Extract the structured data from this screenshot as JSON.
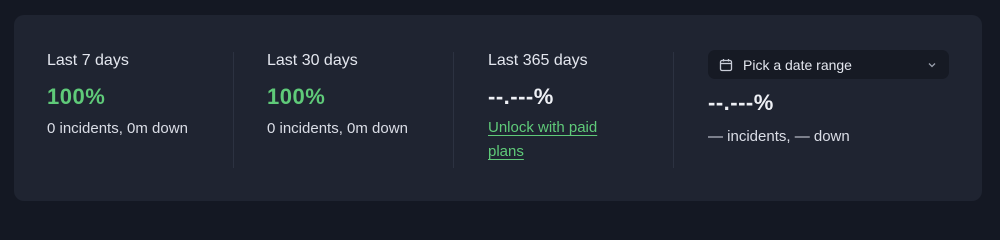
{
  "stats": [
    {
      "period": "Last 7 days",
      "value": "100%",
      "summary": "0 incidents, 0m down"
    },
    {
      "period": "Last 30 days",
      "value": "100%",
      "summary": "0 incidents, 0m down"
    },
    {
      "period": "Last 365 days",
      "value": "--.---%",
      "unlock_link": "Unlock with paid plans"
    }
  ],
  "custom_range": {
    "picker_label": "Pick a date range",
    "value": "--.---%",
    "summary": "— incidents, — down"
  },
  "colors": {
    "background": "#141823",
    "card": "#1f2431",
    "accent_green": "#5fca79",
    "text": "#e3e6ee"
  },
  "icons": {
    "date_picker": "calendar-icon",
    "dropdown": "chevron-down-icon"
  }
}
